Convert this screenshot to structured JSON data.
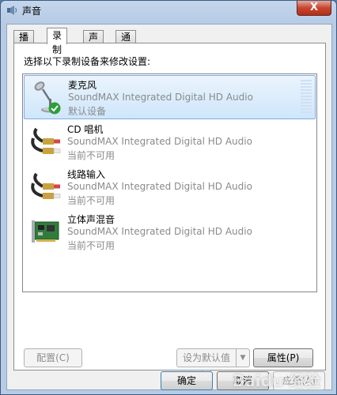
{
  "window": {
    "title": "声音",
    "close_label": "X"
  },
  "tabs": [
    {
      "label": "播放",
      "active": false
    },
    {
      "label": "录制",
      "active": true
    },
    {
      "label": "声音",
      "active": false
    },
    {
      "label": "通信",
      "active": false
    }
  ],
  "panel": {
    "instruction": "选择以下录制设备来修改设置:"
  },
  "devices": [
    {
      "name": "麦克风",
      "driver": "SoundMAX Integrated Digital HD Audio",
      "status": "默认设备",
      "selected": true,
      "icon": "microphone-icon",
      "default_check": true
    },
    {
      "name": "CD 唱机",
      "driver": "SoundMAX Integrated Digital HD Audio",
      "status": "当前不可用",
      "selected": false,
      "icon": "rca-cable-icon"
    },
    {
      "name": "线路输入",
      "driver": "SoundMAX Integrated Digital HD Audio",
      "status": "当前不可用",
      "selected": false,
      "icon": "rca-cable-icon"
    },
    {
      "name": "立体声混音",
      "driver": "SoundMAX Integrated Digital HD Audio",
      "status": "当前不可用",
      "selected": false,
      "icon": "sound-card-icon"
    }
  ],
  "buttons": {
    "configure": "配置(C)",
    "set_default": "设为默认值(S)",
    "properties": "属性(P)",
    "ok": "确定",
    "cancel": "取消",
    "apply": "应用(A)"
  },
  "watermark": "Baidu 经验",
  "colors": {
    "titlebar": "#b7cbe5",
    "selection": "#cfe6fb",
    "close": "#c8452f"
  }
}
